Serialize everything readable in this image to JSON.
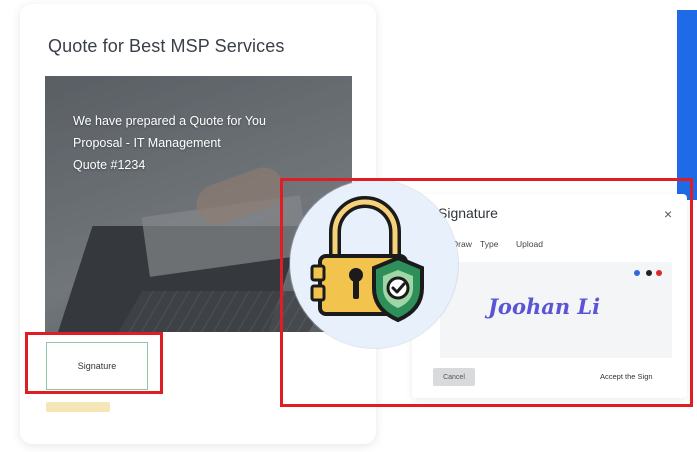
{
  "card": {
    "title": "Quote for Best MSP Services",
    "hero_lines": [
      "We have prepared a Quote for You",
      "Proposal - IT Management",
      "Quote #1234"
    ],
    "signature_button": "Signature"
  },
  "dialog": {
    "title": "Signature",
    "close": "×",
    "tabs": [
      "Draw",
      "Type",
      "Upload"
    ],
    "signature_value": "Joohan Li",
    "pen_colors": [
      "#2e6bd8",
      "#222222",
      "#e0262b"
    ],
    "cancel_label": "Cancel",
    "accept_label": "Accept the Sign"
  },
  "colors": {
    "highlight": "#e11d24",
    "accent_blue": "#1f6ae6",
    "lock_body": "#f2c44e",
    "shield": "#2e8f5a"
  },
  "icons": {
    "lock": "padlock-with-shield-icon"
  }
}
